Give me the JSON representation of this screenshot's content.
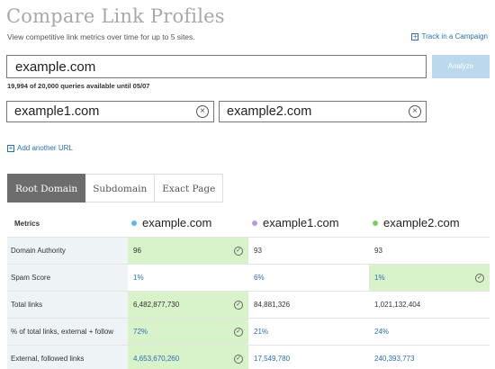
{
  "header": {
    "title": "Compare Link Profiles",
    "subtitle": "View competitive link metrics over time for up to 5 sites.",
    "track_label": "Track in a Campaign"
  },
  "search": {
    "main_value": "example.com",
    "analyze_label": "Analyze",
    "queries_text": "19,994 of 20,000 queries available until 05/07",
    "site1_value": "example1.com",
    "site2_value": "example2.com",
    "add_url_label": "Add another URL"
  },
  "tabs": [
    {
      "label": "Root Domain",
      "active": true
    },
    {
      "label": "Subdomain",
      "active": false
    },
    {
      "label": "Exact Page",
      "active": false
    }
  ],
  "table": {
    "metrics_header": "Metrics",
    "sites": [
      {
        "name": "example.com",
        "color": "#5bb8e8"
      },
      {
        "name": "example1.com",
        "color": "#b39ddb"
      },
      {
        "name": "example2.com",
        "color": "#7ccf5e"
      }
    ],
    "rows": [
      {
        "metric": "Domain Authority",
        "values": [
          "96",
          "93",
          "93"
        ],
        "winner": 0,
        "link": false
      },
      {
        "metric": "Spam Score",
        "values": [
          "1%",
          "6%",
          "1%"
        ],
        "winner": [
          0,
          2
        ],
        "link": true
      },
      {
        "metric": "Total links",
        "values": [
          "6,482,877,730",
          "84,881,326",
          "1,021,132,404"
        ],
        "winner": 0,
        "link": false
      },
      {
        "metric": "% of total links, external + follow",
        "values": [
          "72%",
          "21%",
          "24%"
        ],
        "winner": 0,
        "link": true
      },
      {
        "metric": "External, followed links",
        "values": [
          "4,653,670,260",
          "17,549,780",
          "240,393,773"
        ],
        "winner": 0,
        "link": true
      }
    ]
  }
}
